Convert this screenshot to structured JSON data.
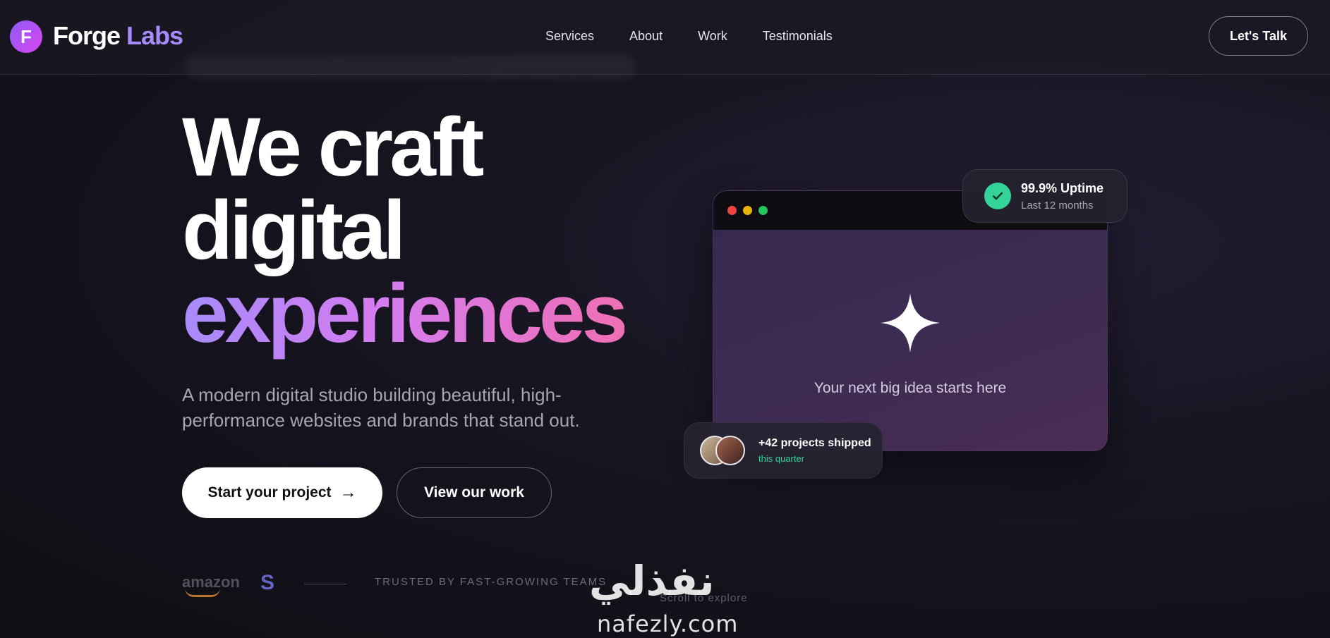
{
  "header": {
    "logo_letter": "F",
    "brand_primary": "Forge",
    "brand_accent": "Labs",
    "nav": [
      "Services",
      "About",
      "Work",
      "Testimonials"
    ],
    "cta_label": "Let's Talk"
  },
  "hero": {
    "line1": "We craft",
    "line2": "digital",
    "line3": "experiences",
    "subtitle": "A modern digital studio building beautiful, high-performance websites and brands that stand out.",
    "primary_button": "Start your project",
    "primary_arrow": "→",
    "secondary_button": "View our work"
  },
  "trusted": {
    "amazon_logo": "amazon",
    "s_logo": "S",
    "label": "TRUSTED BY FAST-GROWING TEAMS",
    "scroll_hint": "Scroll to explore"
  },
  "mockup": {
    "caption": "Your next big idea starts here",
    "window_dots": [
      "#ef4444",
      "#eab308",
      "#22c55e"
    ],
    "uptime_title": "99.9% Uptime",
    "uptime_sub": "Last 12 months",
    "projects_title": "+42 projects shipped",
    "projects_sub": "this quarter"
  },
  "watermark": {
    "arabic": "نفذلي",
    "url": "nafezly.com"
  },
  "colors": {
    "accent_purple": "#a78bfa",
    "accent_pink": "#ef6fb4",
    "success_green": "#34d399"
  }
}
